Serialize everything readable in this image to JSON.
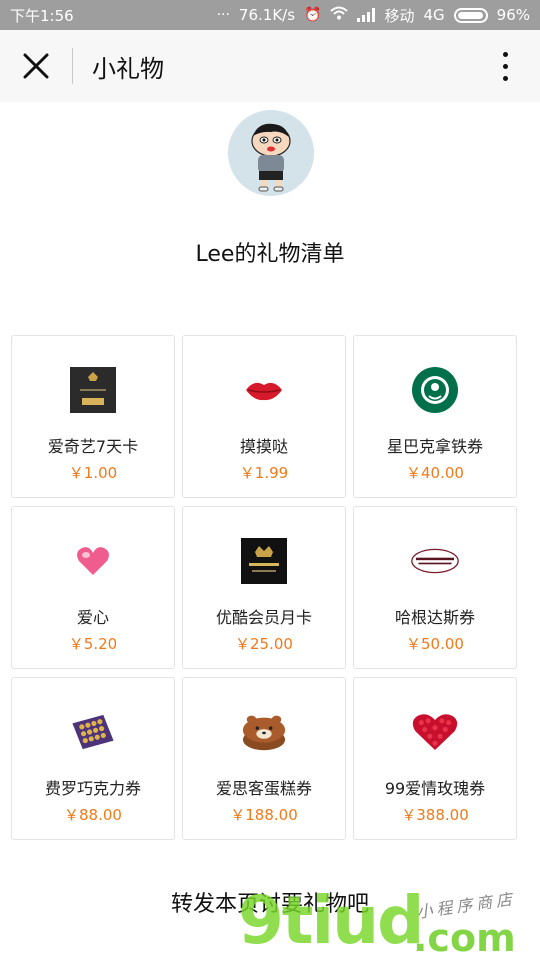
{
  "status_bar": {
    "time": "下午1:56",
    "speed": "76.1K/s",
    "carrier": "移动",
    "network": "4G",
    "battery": "96%"
  },
  "nav": {
    "title": "小礼物",
    "close_icon": "close-icon",
    "more_icon": "more-vertical-icon"
  },
  "page": {
    "title": "Lee的礼物清单",
    "footer": "转发本页讨要礼物吧"
  },
  "gifts": [
    {
      "name": "爱奇艺7天卡",
      "price": "￥1.00",
      "icon": "iqiyi-card-icon"
    },
    {
      "name": "摸摸哒",
      "price": "￥1.99",
      "icon": "lips-icon"
    },
    {
      "name": "星巴克拿铁券",
      "price": "￥40.00",
      "icon": "starbucks-logo-icon"
    },
    {
      "name": "爱心",
      "price": "￥5.20",
      "icon": "heart-icon"
    },
    {
      "name": "优酷会员月卡",
      "price": "￥25.00",
      "icon": "youku-card-icon"
    },
    {
      "name": "哈根达斯券",
      "price": "￥50.00",
      "icon": "haagen-dazs-logo-icon"
    },
    {
      "name": "费罗巧克力券",
      "price": "￥88.00",
      "icon": "chocolate-box-icon"
    },
    {
      "name": "爱思客蛋糕券",
      "price": "￥188.00",
      "icon": "cake-icon"
    },
    {
      "name": "99爱情玫瑰券",
      "price": "￥388.00",
      "icon": "rose-heart-icon"
    }
  ],
  "watermark": {
    "brand": "9tiud",
    "domain": ".com",
    "tagline": "小程序商店"
  },
  "colors": {
    "price": "#f07a1a",
    "status_bar": "#9e9e9e",
    "nav_bar": "#f7f7f7"
  }
}
